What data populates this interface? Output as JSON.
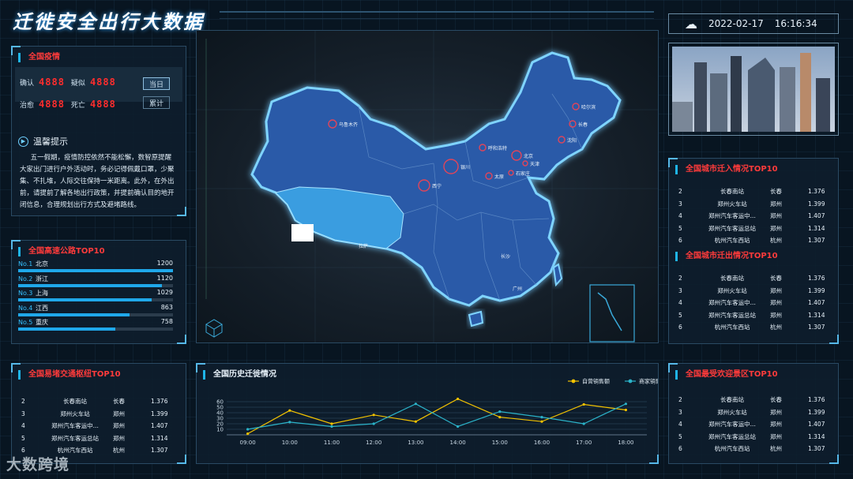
{
  "title": "迁徙安全出行大数据",
  "datetime": {
    "date": "2022-02-17",
    "time": "16:16:34",
    "icon": "cloud-icon"
  },
  "epidemic": {
    "title": "全国疫情",
    "confirmed_label": "确认",
    "confirmed_value": "4888",
    "suspected_label": "疑似",
    "suspected_value": "4888",
    "cured_label": "治愈",
    "cured_value": "4888",
    "dead_label": "死亡",
    "dead_value": "4888",
    "btn_today": "当日",
    "btn_total": "累计"
  },
  "tips": {
    "title": "温馨提示",
    "body": "五一假期，疫情防控依然不能松懈，数智原提醒大家出门进行户外活动时，务必记得佩戴口罩，少聚集、不扎堆，人际交往保持一米距离。此外，在外出前，请提前了解各地出行政策，并提前确认目的地开闭信息，合理规划出行方式及避堵路线。"
  },
  "highway": {
    "title": "全国高速公路TOP10",
    "items": [
      {
        "rank": "No.1",
        "name": "北京",
        "value": "1200",
        "pct": 1.0
      },
      {
        "rank": "No.2",
        "name": "浙江",
        "value": "1120",
        "pct": 0.93
      },
      {
        "rank": "No.3",
        "name": "上海",
        "value": "1029",
        "pct": 0.86
      },
      {
        "rank": "No.4",
        "name": "江西",
        "value": "863",
        "pct": 0.72
      },
      {
        "rank": "No.5",
        "name": "重庆",
        "value": "758",
        "pct": 0.63
      }
    ]
  },
  "hub": {
    "title": "全国易堵交通枢纽TOP10",
    "rows": [
      [
        "2",
        "长春南站",
        "长春",
        "1.376"
      ],
      [
        "3",
        "郑州火车站",
        "郑州",
        "1.399"
      ],
      [
        "4",
        "郑州汽车客运中...",
        "郑州",
        "1.407"
      ],
      [
        "5",
        "郑州汽车客运总站",
        "郑州",
        "1.314"
      ],
      [
        "6",
        "杭州汽车西站",
        "杭州",
        "1.307"
      ]
    ]
  },
  "migrate_in": {
    "title": "全国城市迁入情况TOP10",
    "rows": [
      [
        "2",
        "长春南站",
        "长春",
        "1.376"
      ],
      [
        "3",
        "郑州火车站",
        "郑州",
        "1.399"
      ],
      [
        "4",
        "郑州汽车客运中...",
        "郑州",
        "1.407"
      ],
      [
        "5",
        "郑州汽车客运总站",
        "郑州",
        "1.314"
      ],
      [
        "6",
        "杭州汽车西站",
        "杭州",
        "1.307"
      ]
    ]
  },
  "migrate_out": {
    "title": "全国城市迁出情况TOP10",
    "rows": [
      [
        "2",
        "长春南站",
        "长春",
        "1.376"
      ],
      [
        "3",
        "郑州火车站",
        "郑州",
        "1.399"
      ],
      [
        "4",
        "郑州汽车客运中...",
        "郑州",
        "1.407"
      ],
      [
        "5",
        "郑州汽车客运总站",
        "郑州",
        "1.314"
      ],
      [
        "6",
        "杭州汽车西站",
        "杭州",
        "1.307"
      ]
    ]
  },
  "scenic": {
    "title": "全国最受欢迎景区TOP10",
    "rows": [
      [
        "2",
        "长春南站",
        "长春",
        "1.376"
      ],
      [
        "3",
        "郑州火车站",
        "郑州",
        "1.399"
      ],
      [
        "4",
        "郑州汽车客运中...",
        "郑州",
        "1.407"
      ],
      [
        "5",
        "郑州汽车客运总站",
        "郑州",
        "1.314"
      ],
      [
        "6",
        "杭州汽车西站",
        "杭州",
        "1.307"
      ]
    ]
  },
  "map": {
    "cities": [
      "乌鲁木齐",
      "哈尔滨",
      "长春",
      "沈阳",
      "呼和浩特",
      "北京",
      "天津",
      "石家庄",
      "太原",
      "银川",
      "西宁",
      "拉萨",
      "长沙",
      "广州"
    ],
    "colors": {
      "land": "#2a5aa8",
      "tibet": "#3a9de0",
      "glow": "#7fd4ff"
    }
  },
  "watermark": "大数跨境",
  "chart_data": {
    "type": "line",
    "title": "全国历史迁徙情况",
    "categories": [
      "09:00",
      "10:00",
      "11:00",
      "12:00",
      "13:00",
      "14:00",
      "15:00",
      "16:00",
      "17:00",
      "18:00"
    ],
    "ylim": [
      0,
      60
    ],
    "yticks": [
      10,
      20,
      30,
      40,
      50,
      60
    ],
    "legend_position": "top-right",
    "series": [
      {
        "name": "自营销售额",
        "color": "#f2c200",
        "values": [
          2,
          44,
          20,
          36,
          24,
          65,
          32,
          24,
          55,
          45
        ]
      },
      {
        "name": "商家销售额",
        "color": "#2bb3c9",
        "values": [
          10,
          23,
          15,
          20,
          56,
          15,
          42,
          32,
          20,
          56
        ]
      }
    ]
  }
}
